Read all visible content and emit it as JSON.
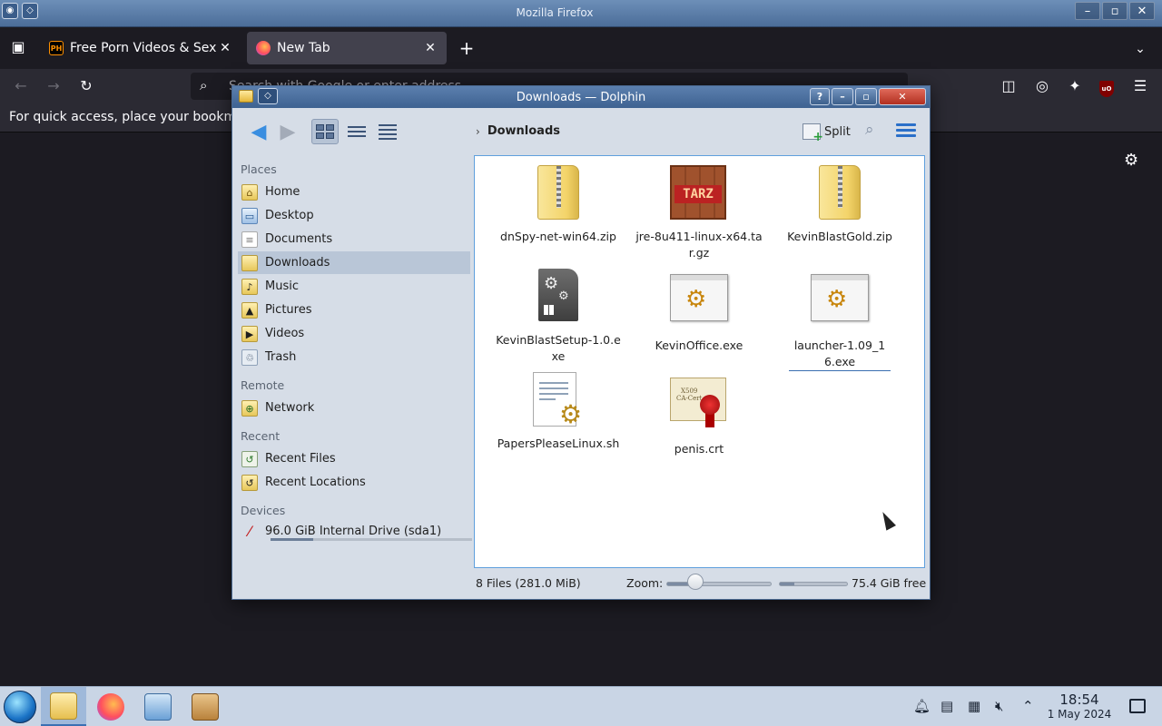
{
  "firefox": {
    "window_title": "Mozilla Firefox",
    "tabs": [
      {
        "label": "Free Porn Videos & Sex M",
        "favicon": "PH"
      },
      {
        "label": "New Tab"
      }
    ],
    "new_tab_symbol": "+",
    "url_placeholder": "Search with Google or enter address",
    "bookmarks_text": "For quick access, place your bookmarks here on the bookmarks toolbar."
  },
  "dolphin": {
    "title": "Downloads — Dolphin",
    "breadcrumb": "Downloads",
    "split_label": "Split",
    "places": {
      "headers": [
        "Places",
        "Remote",
        "Recent",
        "Devices"
      ],
      "items": [
        {
          "label": "Home",
          "icon": "home-icon"
        },
        {
          "label": "Desktop",
          "icon": "desktop-icon"
        },
        {
          "label": "Documents",
          "icon": "documents-icon"
        },
        {
          "label": "Downloads",
          "icon": "downloads-icon",
          "selected": true
        },
        {
          "label": "Music",
          "icon": "music-icon"
        },
        {
          "label": "Pictures",
          "icon": "pictures-icon"
        },
        {
          "label": "Videos",
          "icon": "videos-icon"
        },
        {
          "label": "Trash",
          "icon": "trash-icon"
        }
      ],
      "remote": [
        {
          "label": "Network",
          "icon": "network-icon"
        }
      ],
      "recent": [
        {
          "label": "Recent Files",
          "icon": "recent-files-icon"
        },
        {
          "label": "Recent Locations",
          "icon": "recent-locations-icon"
        }
      ],
      "devices": [
        {
          "label": "96.0 GiB Internal Drive (sda1)",
          "icon": "drive-icon",
          "usage_fraction": 0.21
        }
      ]
    },
    "files": [
      {
        "name": "dnSpy-net-win64.zip",
        "type": "zip"
      },
      {
        "name": "jre-8u411-linux-x64.tar.gz",
        "type": "tar"
      },
      {
        "name": "KevinBlastGold.zip",
        "type": "zip"
      },
      {
        "name": "KevinBlastSetup-1.0.exe",
        "type": "setup"
      },
      {
        "name": "KevinOffice.exe",
        "type": "exe"
      },
      {
        "name": "launcher-1.09_16.exe",
        "type": "exe"
      },
      {
        "name": "PapersPleaseLinux.sh",
        "type": "script"
      },
      {
        "name": "penis.crt",
        "type": "cert"
      }
    ],
    "status": {
      "info": "8 Files (281.0 MiB)",
      "zoom_label": "Zoom:",
      "zoom_fraction": 0.28,
      "free_fraction": 0.21,
      "free_label": "75.4 GiB free"
    }
  },
  "taskbar": {
    "time": "18:54",
    "date": "1 May 2024"
  }
}
